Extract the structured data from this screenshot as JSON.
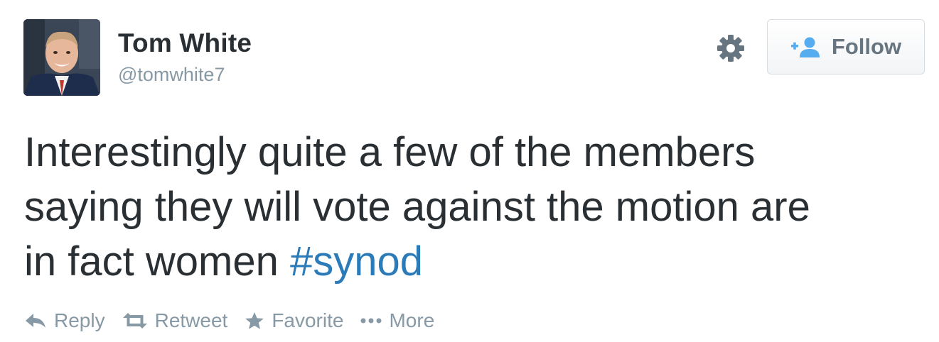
{
  "user": {
    "name": "Tom White",
    "handle": "@tomwhite7"
  },
  "follow_button": {
    "label": "Follow"
  },
  "tweet": {
    "text": "Interestingly quite a few of the members\nsaying they will vote against the motion are\nin fact women ",
    "hashtag": "#synod"
  },
  "actions": {
    "reply": "Reply",
    "retweet": "Retweet",
    "favorite": "Favorite",
    "more": "More"
  },
  "icons": {
    "settings": "gear-icon",
    "follow": "add-user-icon",
    "reply": "reply-icon",
    "retweet": "retweet-icon",
    "favorite": "star-icon",
    "more": "dots-icon"
  },
  "colors": {
    "text": "#292f33",
    "muted": "#8899a6",
    "link": "#2b7bb9",
    "follow_icon": "#55acee"
  }
}
